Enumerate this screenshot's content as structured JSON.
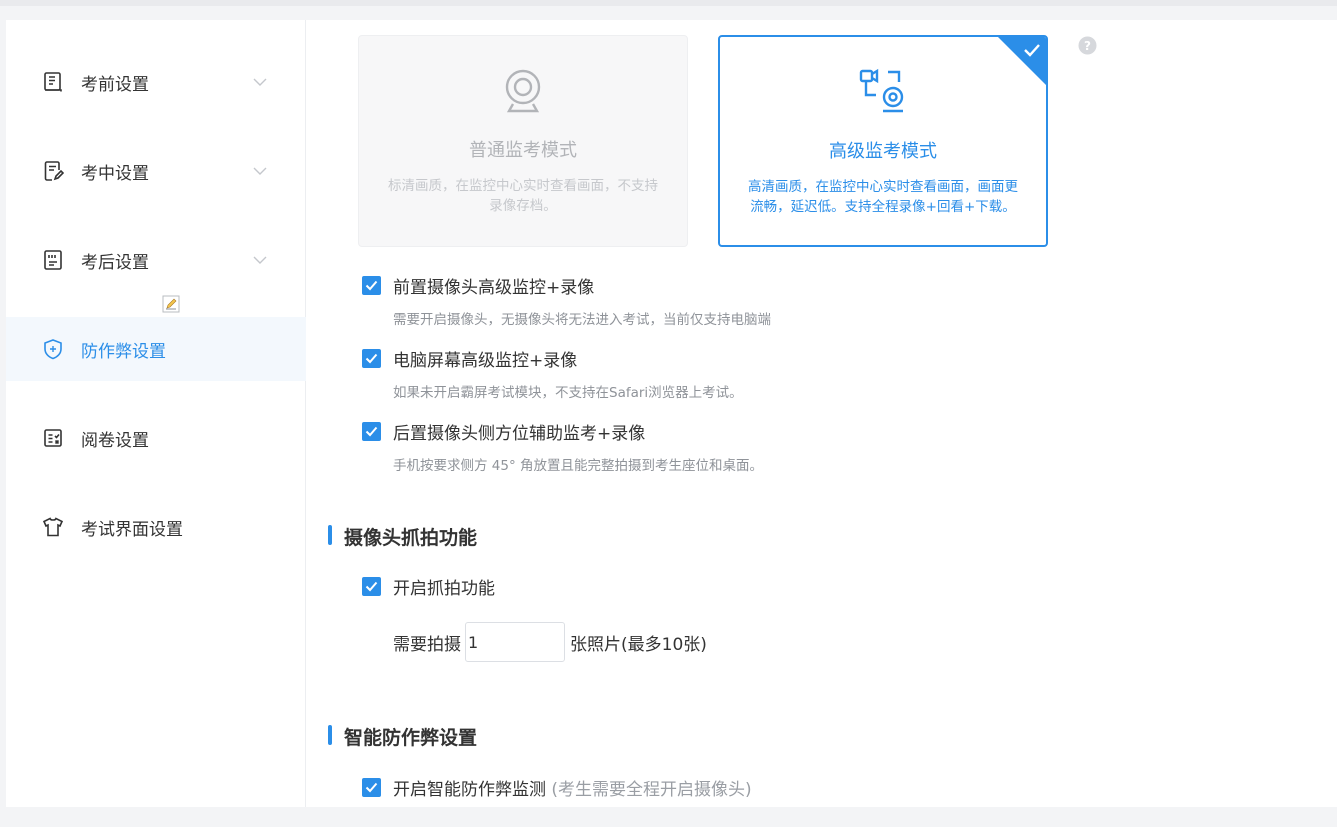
{
  "sidebar": {
    "items": [
      {
        "label": "考前设置",
        "icon": "book-icon",
        "expandable": true,
        "active": false
      },
      {
        "label": "考中设置",
        "icon": "edit-document-icon",
        "expandable": true,
        "active": false
      },
      {
        "label": "考后设置",
        "icon": "report-document-icon",
        "expandable": true,
        "active": false
      },
      {
        "label": "防作弊设置",
        "icon": "shield-icon",
        "expandable": false,
        "active": true
      },
      {
        "label": "阅卷设置",
        "icon": "grading-icon",
        "expandable": false,
        "active": false
      },
      {
        "label": "考试界面设置",
        "icon": "shirt-icon",
        "expandable": false,
        "active": false
      }
    ]
  },
  "modes": {
    "normal": {
      "title": "普通监考模式",
      "desc": "标清画质，在监控中心实时查看画面，不支持录像存档。",
      "selected": false
    },
    "advanced": {
      "title": "高级监考模式",
      "desc": "高清画质，在监控中心实时查看画面，画面更流畅，延迟低。支持全程录像+回看+下载。",
      "selected": true
    }
  },
  "options": [
    {
      "title": "前置摄像头高级监控+录像",
      "desc": "需要开启摄像头，无摄像头将无法进入考试，当前仅支持电脑端",
      "checked": true
    },
    {
      "title": "电脑屏幕高级监控+录像",
      "desc": "如果未开启霸屏考试模块，不支持在Safari浏览器上考试。",
      "checked": true
    },
    {
      "title": "后置摄像头侧方位辅助监考+录像",
      "desc": "手机按要求侧方 45° 角放置且能完整拍摄到考生座位和桌面。",
      "checked": true
    }
  ],
  "snapshot": {
    "section_title": "摄像头抓拍功能",
    "enable_label": "开启抓拍功能",
    "enabled": true,
    "count_prefix": "需要拍摄",
    "count_value": "1",
    "count_suffix": "张照片(最多10张)"
  },
  "smart": {
    "section_title": "智能防作弊设置",
    "enable_label": "开启智能防作弊监测",
    "enable_note": "(考生需要全程开启摄像头)",
    "enabled": true
  },
  "colors": {
    "accent": "#2b8ee8",
    "active_bg": "#f3f8fd"
  }
}
